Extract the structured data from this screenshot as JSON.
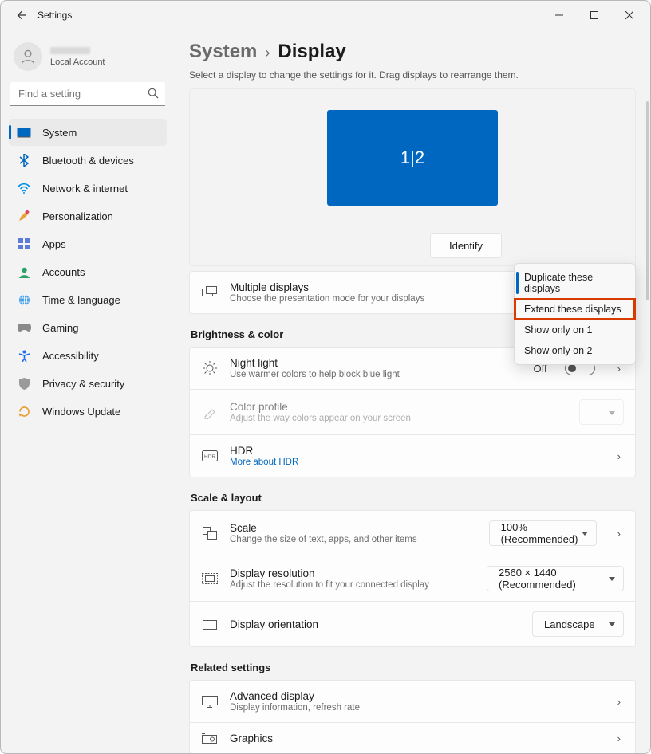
{
  "window": {
    "title": "Settings"
  },
  "profile": {
    "account_type": "Local Account"
  },
  "search": {
    "placeholder": "Find a setting"
  },
  "sidebar": {
    "items": [
      {
        "label": "System"
      },
      {
        "label": "Bluetooth & devices"
      },
      {
        "label": "Network & internet"
      },
      {
        "label": "Personalization"
      },
      {
        "label": "Apps"
      },
      {
        "label": "Accounts"
      },
      {
        "label": "Time & language"
      },
      {
        "label": "Gaming"
      },
      {
        "label": "Accessibility"
      },
      {
        "label": "Privacy & security"
      },
      {
        "label": "Windows Update"
      }
    ]
  },
  "breadcrumb": {
    "parent": "System",
    "current": "Display"
  },
  "subtitle": "Select a display to change the settings for it. Drag displays to rearrange them.",
  "arrange": {
    "monitor_label": "1|2",
    "identify": "Identify"
  },
  "dropdown": {
    "options": [
      "Duplicate these displays",
      "Extend these displays",
      "Show only on 1",
      "Show only on 2"
    ]
  },
  "multiple": {
    "title": "Multiple displays",
    "sub": "Choose the presentation mode for your displays"
  },
  "sections": {
    "brightness": "Brightness & color",
    "scale": "Scale & layout",
    "related": "Related settings"
  },
  "nightlight": {
    "title": "Night light",
    "sub": "Use warmer colors to help block blue light",
    "state": "Off"
  },
  "colorprofile": {
    "title": "Color profile",
    "sub": "Adjust the way colors appear on your screen"
  },
  "hdr": {
    "title": "HDR",
    "link": "More about HDR"
  },
  "scale": {
    "title": "Scale",
    "sub": "Change the size of text, apps, and other items",
    "value": "100% (Recommended)"
  },
  "resolution": {
    "title": "Display resolution",
    "sub": "Adjust the resolution to fit your connected display",
    "value": "2560 × 1440 (Recommended)"
  },
  "orientation": {
    "title": "Display orientation",
    "value": "Landscape"
  },
  "advanced": {
    "title": "Advanced display",
    "sub": "Display information, refresh rate"
  },
  "graphics": {
    "title": "Graphics"
  }
}
